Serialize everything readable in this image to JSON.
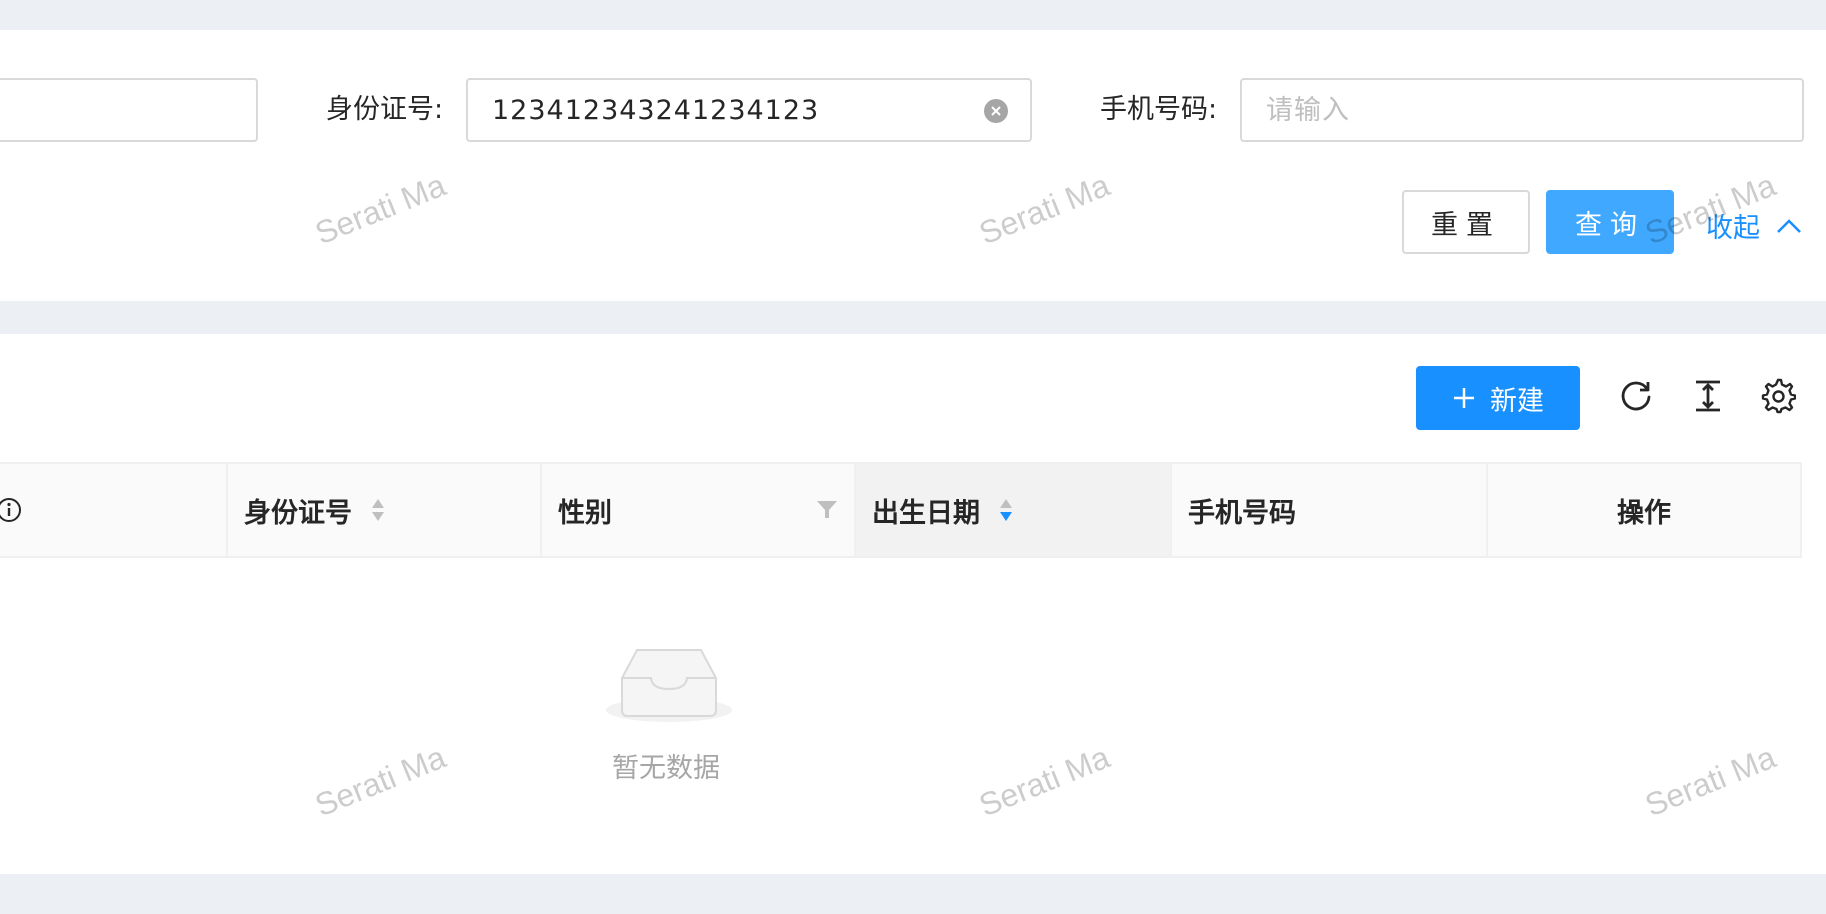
{
  "search": {
    "id_card_label": "身份证号:",
    "id_card_value": "123412343241234123",
    "phone_label": "手机号码:",
    "phone_placeholder": "请输入",
    "reset_label": "重置",
    "query_label": "查询",
    "collapse_label": "收起"
  },
  "toolbar": {
    "new_label": "新建",
    "icons": [
      "reload-icon",
      "column-height-icon",
      "setting-icon"
    ]
  },
  "table": {
    "columns": [
      {
        "label": "身份证号",
        "sort": "none"
      },
      {
        "label": "性别",
        "filter": true
      },
      {
        "label": "出生日期",
        "sort": "descend"
      },
      {
        "label": "手机号码"
      },
      {
        "label": "操作"
      }
    ],
    "empty_text": "暂无数据"
  },
  "watermark": "Serati Ma",
  "colors": {
    "primary": "#1890ff",
    "query_button": "#40a9ff",
    "background": "#eceff4"
  }
}
